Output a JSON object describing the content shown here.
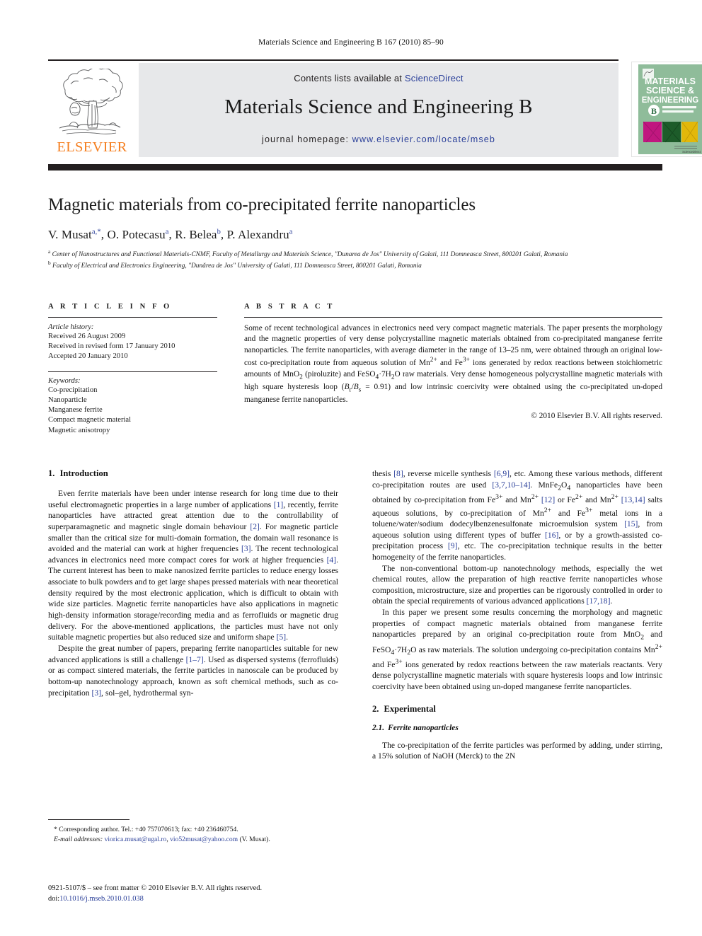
{
  "running_head": "Materials Science and Engineering B 167 (2010) 85–90",
  "masthead": {
    "contents_prefix": "Contents lists available at ",
    "sciencedirect": "ScienceDirect",
    "journal_title": "Materials Science and Engineering B",
    "homepage_prefix": "journal homepage: ",
    "homepage_url": "www.elsevier.com/locate/mseb",
    "publisher_logo_text": "ELSEVIER",
    "cover": {
      "line1": "MATERIALS",
      "line2": "SCIENCE &",
      "line3": "ENGINEERING",
      "badge": "B",
      "badge_sub1": "ADVANCED FUNCTIONAL",
      "badge_sub2": "SOLID-STATE MATERIALS",
      "footer": "ScienceDirect"
    }
  },
  "colors": {
    "elsevier_orange": "#f57f20",
    "link_blue": "#2a3f99",
    "band_gray": "#e7e8ea",
    "rule_black": "#231f20",
    "cover_green": "#8fbc9a"
  },
  "title": "Magnetic materials from co-precipitated ferrite nanoparticles",
  "authors_html": "V. Musat<sup>a,*</sup>, O. Potecasu<sup>a</sup>, R. Belea<sup>b</sup>, P. Alexandru<sup>a</sup>",
  "authors_plain": "V. Musat a,*, O. Potecasu a, R. Belea b, P. Alexandru a",
  "affiliations": [
    "Center of Nanostructures and Functional Materials-CNMF, Faculty of Metallurgy and Materials Science, \"Dunarea de Jos\" University of Galati, 111 Domneasca Street, 800201 Galati, Romania",
    "Faculty of Electrical and Electronics Engineering, \"Dunărea de Jos\" University of Galati, 111 Domneasca Street, 800201 Galati, Romania"
  ],
  "article_info": {
    "heading": "A R T I C L E     I N F O",
    "history_label": "Article history:",
    "history": [
      "Received 26 August 2009",
      "Received in revised form 17 January 2010",
      "Accepted 20 January 2010"
    ],
    "keywords_label": "Keywords:",
    "keywords": [
      "Co-precipitation",
      "Nanoparticle",
      "Manganese ferrite",
      "Compact magnetic material",
      "Magnetic anisotropy"
    ]
  },
  "abstract": {
    "heading": "A B S T R A C T",
    "text": "Some of recent technological advances in electronics need very compact magnetic materials. The paper presents the morphology and the magnetic properties of very dense polycrystalline magnetic materials obtained from co-precipitated manganese ferrite nanoparticles. The ferrite nanoparticles, with average diameter in the range of 13–25 nm, were obtained through an original low-cost co-precipitation route from aqueous solution of Mn2+ and Fe3+ ions generated by redox reactions between stoichiometric amounts of MnO2 (piroluzite) and FeSO4·7H2O raw materials. Very dense homogeneous polycrystalline magnetic materials with high square hysteresis loop (Br/Bs = 0.91) and low intrinsic coercivity were obtained using the co-precipitated un-doped manganese ferrite nanoparticles.",
    "copyright": "© 2010 Elsevier B.V. All rights reserved."
  },
  "sections": {
    "introduction": {
      "number": "1.",
      "title": "Introduction",
      "paragraphs_left": [
        "Even ferrite materials have been under intense research for long time due to their useful electromagnetic properties in a large number of applications [1], recently, ferrite nanoparticles have attracted great attention due to the controllability of superparamagnetic and magnetic single domain behaviour [2]. For magnetic particle smaller than the critical size for multi-domain formation, the domain wall resonance is avoided and the material can work at higher frequencies [3]. The recent technological advances in electronics need more compact cores for work at higher frequencies [4]. The current interest has been to make nanosized ferrite particles to reduce energy losses associate to bulk powders and to get large shapes pressed materials with near theoretical density required by the most electronic application, which is difficult to obtain with wide size particles. Magnetic ferrite nanoparticles have also applications in magnetic high-density information storage/recording media and as ferrofluids or magnetic drug delivery. For the above-mentioned applications, the particles must have not only suitable magnetic properties but also reduced size and uniform shape [5].",
        "Despite the great number of papers, preparing ferrite nanoparticles suitable for new advanced applications is still a challenge [1–7]. Used as dispersed systems (ferrofluids) or as compact sintered materials, the ferrite particles in nanoscale can be produced by bottom-up nanotechnology approach, known as soft chemical methods, such as co-precipitation [3], sol–gel, hydrothermal syn-"
      ],
      "paragraphs_right": [
        "thesis [8], reverse micelle synthesis [6,9], etc. Among these various methods, different co-precipitation routes are used [3,7,10–14]. MnFe2O4 nanoparticles have been obtained by co-precipitation from Fe3+ and Mn2+ [12] or Fe2+ and Mn2+ [13,14] salts aqueous solutions, by co-precipitation of Mn2+ and Fe3+ metal ions in a toluene/water/sodium dodecylbenzenesulfonate microemulsion system [15], from aqueous solution using different types of buffer [16], or by a growth-assisted co-precipitation process [9], etc. The co-precipitation technique results in the better homogeneity of the ferrite nanoparticles.",
        "The non-conventional bottom-up nanotechnology methods, especially the wet chemical routes, allow the preparation of high reactive ferrite nanoparticles whose composition, microstructure, size and properties can be rigorously controlled in order to obtain the special requirements of various advanced applications [17,18].",
        "In this paper we present some results concerning the morphology and magnetic properties of compact magnetic materials obtained from manganese ferrite nanoparticles prepared by an original co-precipitation route from MnO2 and FeSO4·7H2O as raw materials. The solution undergoing co-precipitation contains Mn2+ and Fe3+ ions generated by redox reactions between the raw materials reactants. Very dense polycrystalline magnetic materials with square hysteresis loops and low intrinsic coercivity have been obtained using un-doped manganese ferrite nanoparticles."
      ]
    },
    "experimental": {
      "number": "2.",
      "title": "Experimental",
      "sub_number": "2.1.",
      "sub_title": "Ferrite nanoparticles",
      "paragraph": "The co-precipitation of the ferrite particles was performed by adding, under stirring, a 15% solution of NaOH (Merck) to the 2N"
    }
  },
  "footnotes": {
    "corresponding": "* Corresponding author. Tel.: +40 757070613; fax: +40 236460754.",
    "email_label": "E-mail addresses:",
    "email1": "viorica.musat@ugal.ro",
    "email2": "vio52musat@yahoo.com",
    "email_suffix": "(V. Musat)."
  },
  "imprint": {
    "line1": "0921-5107/$ – see front matter © 2010 Elsevier B.V. All rights reserved.",
    "doi_label": "doi:",
    "doi_value": "10.1016/j.mseb.2010.01.038"
  }
}
